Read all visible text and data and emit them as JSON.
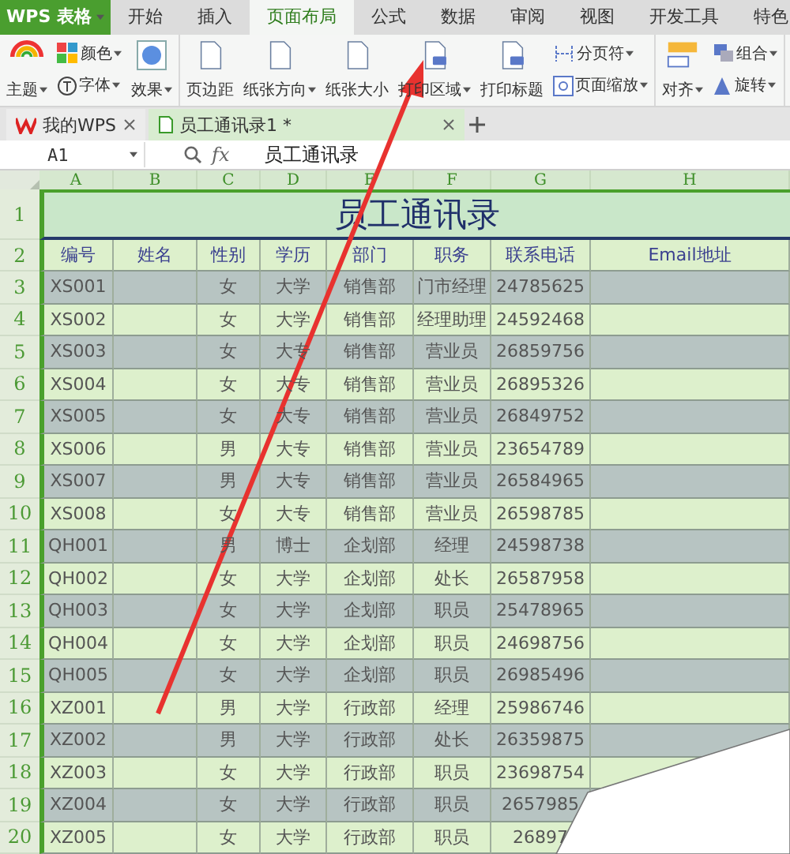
{
  "app_menu": {
    "label": "WPS 表格"
  },
  "menu_tabs": [
    {
      "label": "开始",
      "selected": false
    },
    {
      "label": "插入",
      "selected": false
    },
    {
      "label": "页面布局",
      "selected": true
    },
    {
      "label": "公式",
      "selected": false
    },
    {
      "label": "数据",
      "selected": false
    },
    {
      "label": "审阅",
      "selected": false
    },
    {
      "label": "视图",
      "selected": false
    },
    {
      "label": "开发工具",
      "selected": false
    },
    {
      "label": "特色",
      "selected": false
    }
  ],
  "ribbon_groups": [
    {
      "items": [
        {
          "label": "主题",
          "kind": "large",
          "dropdown": true
        },
        {
          "label": "颜色",
          "kind": "small",
          "dropdown": true
        },
        {
          "label": "字体",
          "kind": "small",
          "dropdown": true
        },
        {
          "label": "效果",
          "kind": "large",
          "dropdown": true
        }
      ]
    },
    {
      "items": [
        {
          "label": "页边距",
          "kind": "large",
          "dropdown": false
        },
        {
          "label": "纸张方向",
          "kind": "large",
          "dropdown": true
        },
        {
          "label": "纸张大小",
          "kind": "large",
          "dropdown": false
        },
        {
          "label": "打印区域",
          "kind": "large",
          "dropdown": true
        },
        {
          "label": "打印标题",
          "kind": "large",
          "dropdown": false
        },
        {
          "label": "分页符",
          "kind": "small",
          "dropdown": true
        },
        {
          "label": "页面缩放",
          "kind": "small",
          "dropdown": true
        }
      ]
    },
    {
      "items": [
        {
          "label": "对齐",
          "kind": "large",
          "dropdown": true
        },
        {
          "label": "组合",
          "kind": "small",
          "dropdown": true
        },
        {
          "label": "旋转",
          "kind": "small",
          "dropdown": true
        }
      ]
    }
  ],
  "doc_tabs": [
    {
      "label": "我的WPS",
      "selected": false
    },
    {
      "label": "员工通讯录1 *",
      "selected": true
    }
  ],
  "formula_bar": {
    "cell": "A1",
    "function_label": "fx",
    "formula": "员工通讯录"
  },
  "sheet": {
    "columns": [
      "A",
      "B",
      "C",
      "D",
      "E",
      "F",
      "G",
      "H"
    ],
    "title_row": {
      "number": "1",
      "title": "员工通讯录"
    },
    "header_row": {
      "number": "2",
      "cells": [
        "编号",
        "姓名",
        "性别",
        "学历",
        "部门",
        "职务",
        "联系电话",
        "Email地址"
      ]
    },
    "rows": [
      {
        "number": "3",
        "shaded": true,
        "cells": [
          "XS001",
          "",
          "女",
          "大学",
          "销售部",
          "门市经理",
          "24785625",
          ""
        ]
      },
      {
        "number": "4",
        "shaded": false,
        "cells": [
          "XS002",
          "",
          "女",
          "大学",
          "销售部",
          "经理助理",
          "24592468",
          ""
        ]
      },
      {
        "number": "5",
        "shaded": true,
        "cells": [
          "XS003",
          "",
          "女",
          "大专",
          "销售部",
          "营业员",
          "26859756",
          ""
        ]
      },
      {
        "number": "6",
        "shaded": false,
        "cells": [
          "XS004",
          "",
          "女",
          "大专",
          "销售部",
          "营业员",
          "26895326",
          ""
        ]
      },
      {
        "number": "7",
        "shaded": true,
        "cells": [
          "XS005",
          "",
          "女",
          "大专",
          "销售部",
          "营业员",
          "26849752",
          ""
        ]
      },
      {
        "number": "8",
        "shaded": false,
        "cells": [
          "XS006",
          "",
          "男",
          "大专",
          "销售部",
          "营业员",
          "23654789",
          ""
        ]
      },
      {
        "number": "9",
        "shaded": true,
        "cells": [
          "XS007",
          "",
          "男",
          "大专",
          "销售部",
          "营业员",
          "26584965",
          ""
        ]
      },
      {
        "number": "10",
        "shaded": false,
        "cells": [
          "XS008",
          "",
          "女",
          "大专",
          "销售部",
          "营业员",
          "26598785",
          ""
        ]
      },
      {
        "number": "11",
        "shaded": true,
        "cells": [
          "QH001",
          "",
          "男",
          "博士",
          "企划部",
          "经理",
          "24598738",
          ""
        ]
      },
      {
        "number": "12",
        "shaded": false,
        "cells": [
          "QH002",
          "",
          "女",
          "大学",
          "企划部",
          "处长",
          "26587958",
          ""
        ]
      },
      {
        "number": "13",
        "shaded": true,
        "cells": [
          "QH003",
          "",
          "女",
          "大学",
          "企划部",
          "职员",
          "25478965",
          ""
        ]
      },
      {
        "number": "14",
        "shaded": false,
        "cells": [
          "QH004",
          "",
          "女",
          "大学",
          "企划部",
          "职员",
          "24698756",
          ""
        ]
      },
      {
        "number": "15",
        "shaded": true,
        "cells": [
          "QH005",
          "",
          "女",
          "大学",
          "企划部",
          "职员",
          "26985496",
          ""
        ]
      },
      {
        "number": "16",
        "shaded": false,
        "cells": [
          "XZ001",
          "",
          "男",
          "大学",
          "行政部",
          "经理",
          "25986746",
          ""
        ]
      },
      {
        "number": "17",
        "shaded": true,
        "cells": [
          "XZ002",
          "",
          "男",
          "大学",
          "行政部",
          "处长",
          "26359875",
          ""
        ]
      },
      {
        "number": "18",
        "shaded": false,
        "cells": [
          "XZ003",
          "",
          "女",
          "大学",
          "行政部",
          "职员",
          "23698754",
          ""
        ]
      },
      {
        "number": "19",
        "shaded": true,
        "cells": [
          "XZ004",
          "",
          "女",
          "大学",
          "行政部",
          "职员",
          "2657985",
          ""
        ]
      },
      {
        "number": "20",
        "shaded": false,
        "cells": [
          "XZ005",
          "",
          "女",
          "大学",
          "行政部",
          "职员",
          "26897",
          ""
        ]
      }
    ]
  }
}
